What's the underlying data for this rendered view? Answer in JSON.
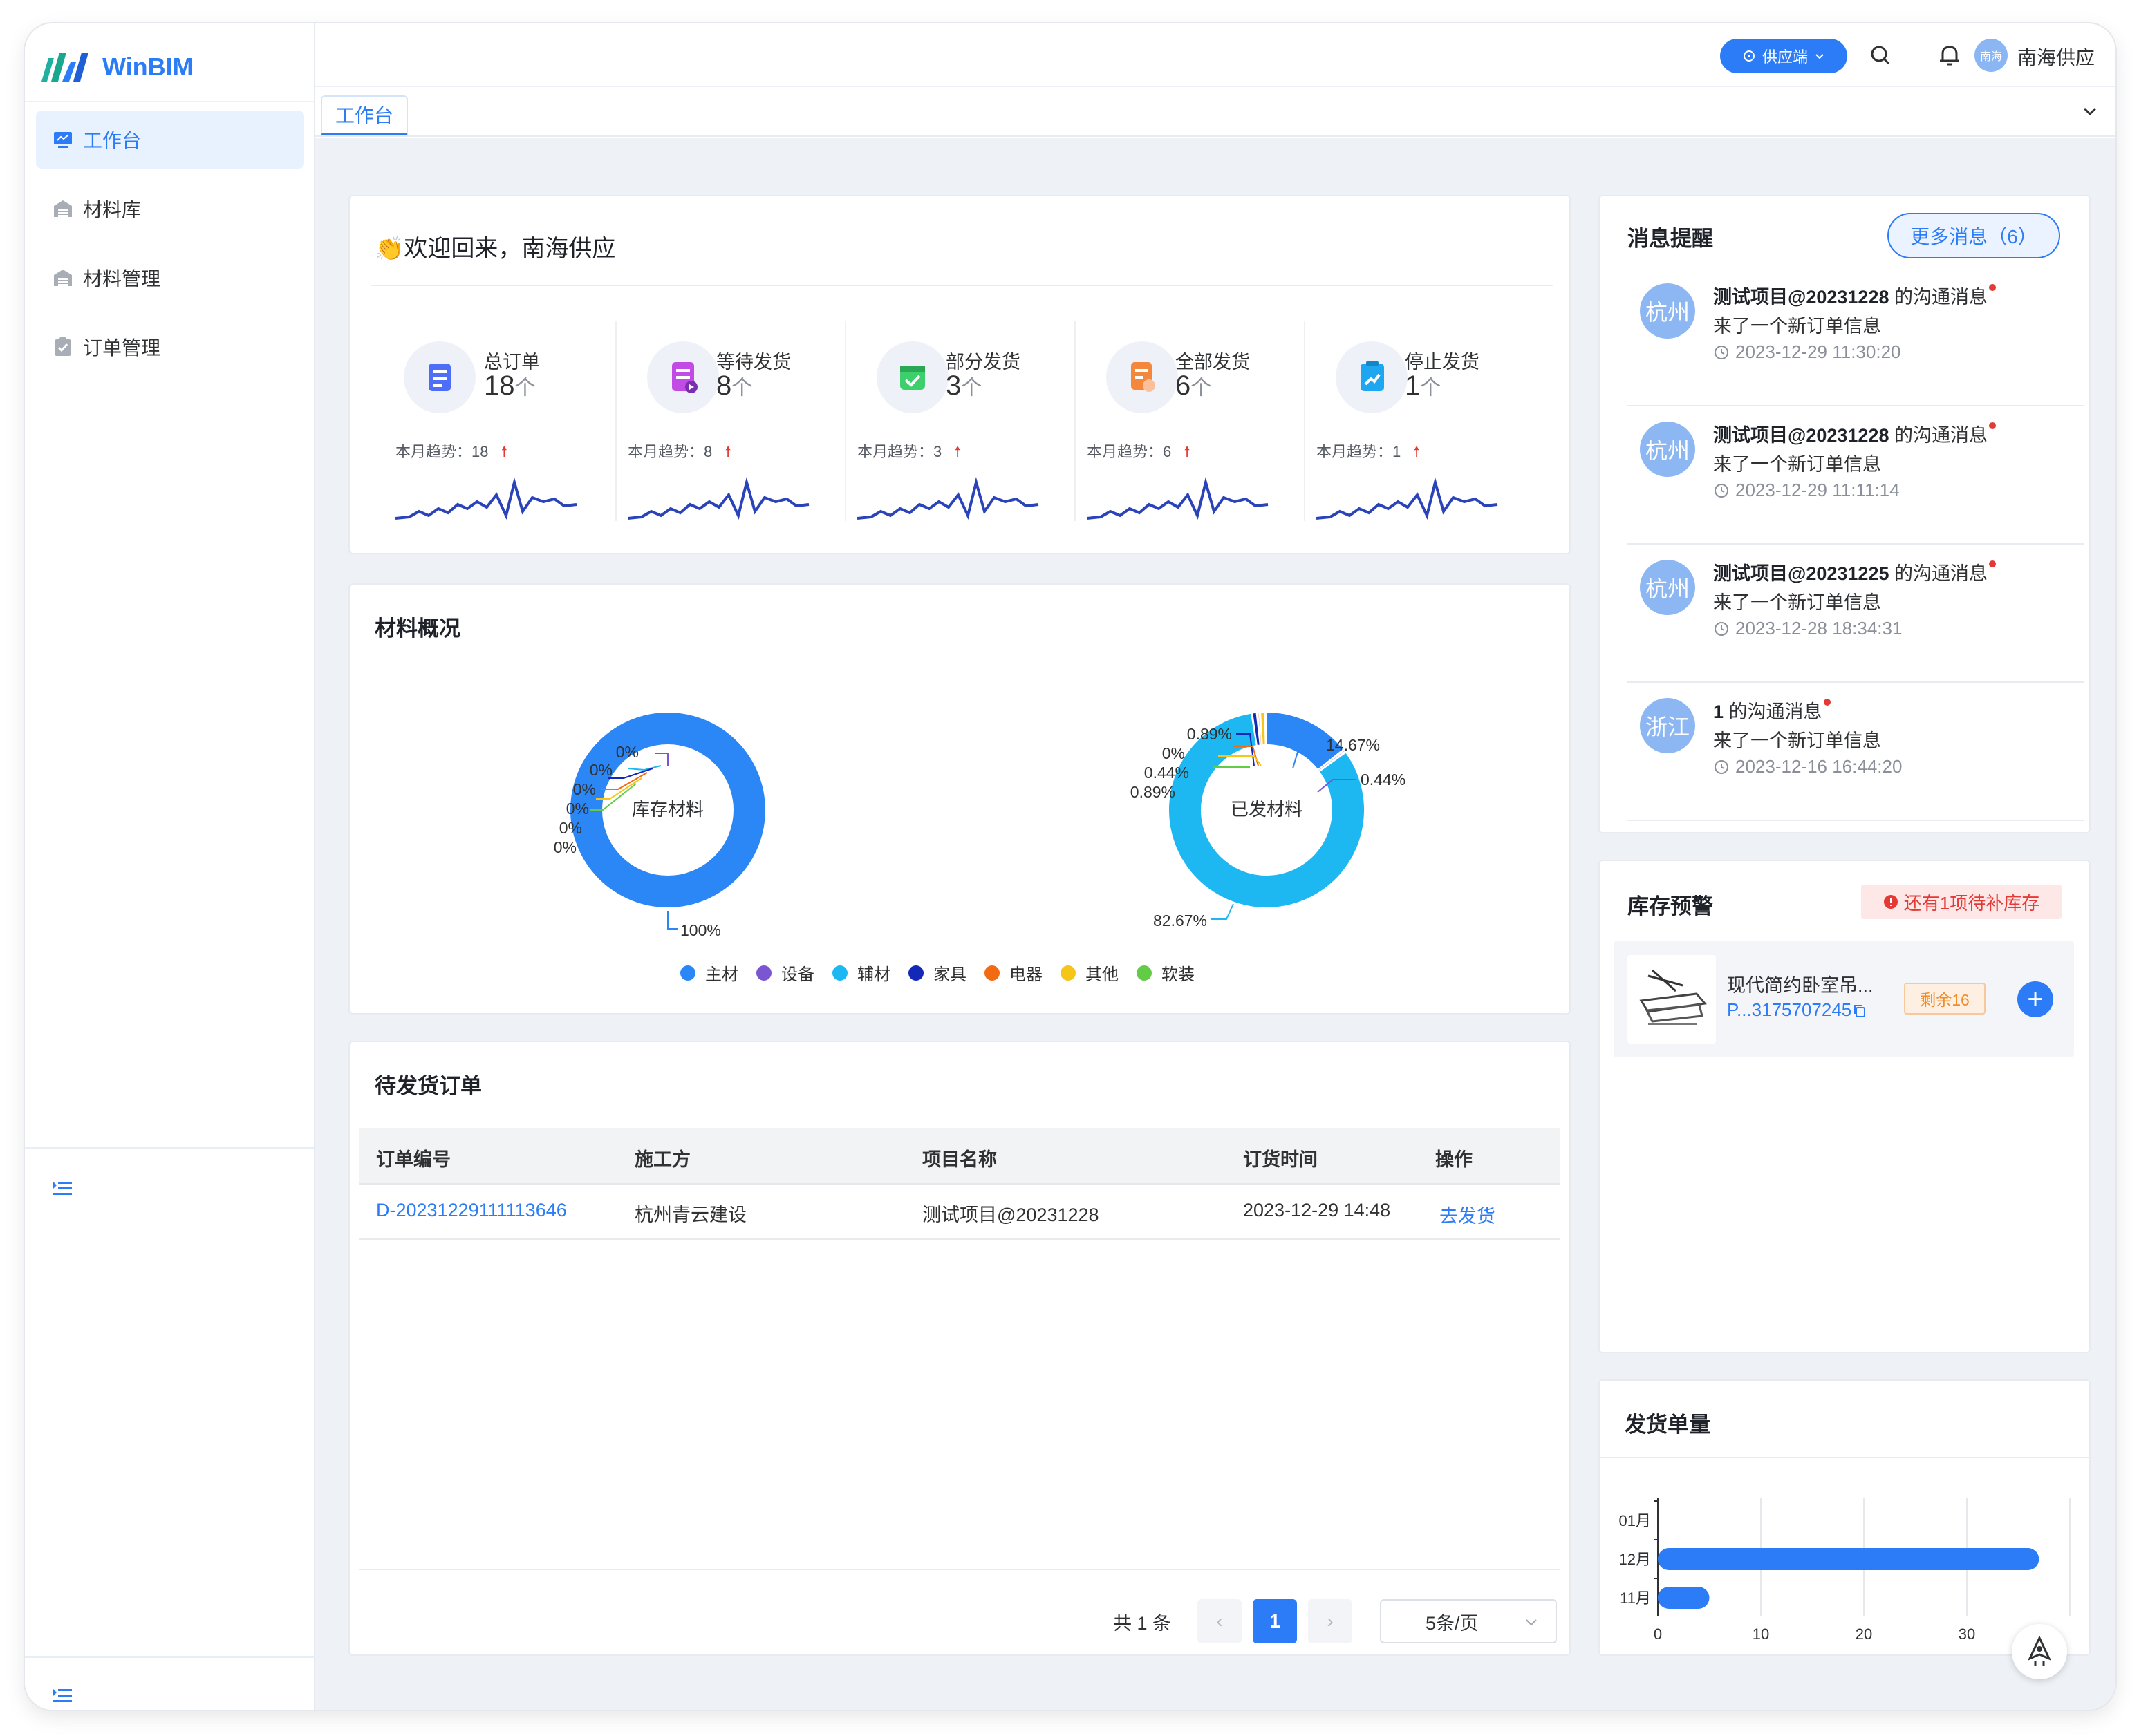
{
  "app": {
    "logo_text": "WinBIM"
  },
  "sidebar": {
    "items": [
      {
        "label": "工作台",
        "icon": "monitor-icon",
        "active": true
      },
      {
        "label": "材料库",
        "icon": "warehouse-icon",
        "active": false
      },
      {
        "label": "材料管理",
        "icon": "warehouse-icon",
        "active": false
      },
      {
        "label": "订单管理",
        "icon": "clipboard-check-icon",
        "active": false
      }
    ],
    "collapse_icon": "indent-icon"
  },
  "topbar": {
    "role_label": "供应端",
    "avatar_text": "南海",
    "user_name": "南海供应"
  },
  "tabs": [
    {
      "label": "工作台"
    }
  ],
  "welcome": {
    "emoji": "👏",
    "title": "欢迎回来，南海供应",
    "stats": [
      {
        "label": "总订单",
        "value": "18",
        "unit": "个",
        "trend_label": "本月趋势：",
        "trend_value": "18",
        "icon": "document-icon",
        "color": "#4f6ef7"
      },
      {
        "label": "等待发货",
        "value": "8",
        "unit": "个",
        "trend_label": "本月趋势：",
        "trend_value": "8",
        "icon": "pending-doc-icon",
        "color": "#c24be6"
      },
      {
        "label": "部分发货",
        "value": "3",
        "unit": "个",
        "trend_label": "本月趋势：",
        "trend_value": "3",
        "icon": "check-box-icon",
        "color": "#3ccf6b"
      },
      {
        "label": "全部发货",
        "value": "6",
        "unit": "个",
        "trend_label": "本月趋势：",
        "trend_value": "6",
        "icon": "stamp-doc-icon",
        "color": "#f5873d"
      },
      {
        "label": "停止发货",
        "value": "1",
        "unit": "个",
        "trend_label": "本月趋势：",
        "trend_value": "1",
        "icon": "chart-up-icon",
        "color": "#1fa6f0"
      }
    ]
  },
  "materials": {
    "title": "材料概况",
    "legend": [
      {
        "name": "主材",
        "color": "#2b86f6"
      },
      {
        "name": "设备",
        "color": "#7a57d1"
      },
      {
        "name": "辅材",
        "color": "#1db8f2"
      },
      {
        "name": "家具",
        "color": "#1328b6"
      },
      {
        "name": "电器",
        "color": "#f26a12"
      },
      {
        "name": "其他",
        "color": "#f5c518"
      },
      {
        "name": "软装",
        "color": "#62cc47"
      }
    ]
  },
  "chart_data": [
    {
      "type": "pie",
      "title": "库存材料",
      "categories": [
        "主材",
        "设备",
        "辅材",
        "家具",
        "电器",
        "其他",
        "软装"
      ],
      "values": [
        100,
        0,
        0,
        0,
        0,
        0,
        0
      ],
      "labels": [
        "100%",
        "0%",
        "0%",
        "0%",
        "0%",
        "0%",
        "0%"
      ]
    },
    {
      "type": "pie",
      "title": "已发材料",
      "categories": [
        "主材",
        "设备",
        "辅材",
        "家具",
        "电器",
        "其他",
        "软装"
      ],
      "values": [
        14.67,
        0.44,
        82.67,
        0.89,
        0.44,
        0.89,
        0
      ],
      "labels": [
        "14.67%",
        "0.44%",
        "82.67%",
        "0.89%",
        "0.44%",
        "0.89%",
        "0%"
      ]
    },
    {
      "type": "bar",
      "orientation": "horizontal",
      "title": "发货单量",
      "categories": [
        "01月",
        "12月",
        "11月"
      ],
      "values": [
        0,
        37,
        5
      ],
      "x_ticks": [
        "0",
        "10",
        "20",
        "30"
      ],
      "xlim": [
        0,
        40
      ]
    }
  ],
  "orders": {
    "title": "待发货订单",
    "columns": [
      "订单编号",
      "施工方",
      "项目名称",
      "订货时间",
      "操作"
    ],
    "rows": [
      {
        "id": "D-20231229111113646",
        "builder": "杭州青云建设",
        "project": "测试项目@20231228",
        "time": "2023-12-29 14:48",
        "action": "去发货"
      }
    ],
    "total_text": "共 1 条",
    "current_page": "1",
    "page_size": "5条/页"
  },
  "messages": {
    "title": "消息提醒",
    "more_label": "更多消息（6）",
    "items": [
      {
        "avatar": "杭州",
        "project": "测试项目@20231228",
        "suffix": " 的沟通消息",
        "body": "来了一个新订单信息",
        "time": "2023-12-29 11:30:20"
      },
      {
        "avatar": "杭州",
        "project": "测试项目@20231228",
        "suffix": " 的沟通消息",
        "body": "来了一个新订单信息",
        "time": "2023-12-29 11:11:14"
      },
      {
        "avatar": "杭州",
        "project": "测试项目@20231225",
        "suffix": " 的沟通消息",
        "body": "来了一个新订单信息",
        "time": "2023-12-28 18:34:31"
      },
      {
        "avatar": "浙江",
        "project": "1",
        "suffix": " 的沟通消息",
        "body": "来了一个新订单信息",
        "time": "2023-12-16 16:44:20"
      }
    ]
  },
  "stock": {
    "title": "库存预警",
    "badge": "还有1项待补库存",
    "item_name": "现代简约卧室吊...",
    "item_code": "P...3175707245",
    "remain": "剩余16"
  },
  "shipping": {
    "title": "发货单量"
  }
}
